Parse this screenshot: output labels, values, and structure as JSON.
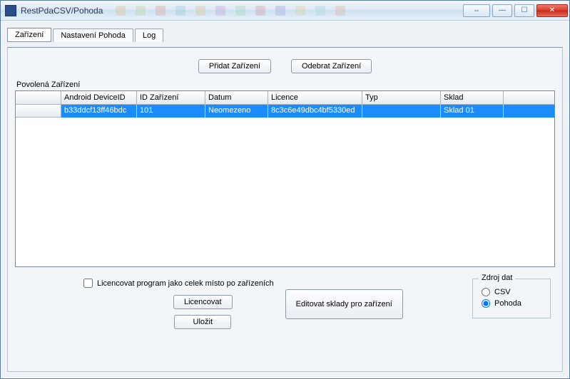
{
  "window": {
    "title": "RestPdaCSV/Pohoda"
  },
  "tabs": {
    "items": [
      {
        "label": "Zařízení",
        "active": true
      },
      {
        "label": "Nastavení Pohoda",
        "active": false
      },
      {
        "label": "Log",
        "active": false
      }
    ]
  },
  "buttons": {
    "add_device": "Přidat Zařízení",
    "remove_device": "Odebrat Zařízení",
    "license": "Licencovat",
    "save": "Uložit",
    "edit_stores": "Editovat sklady pro zařízení"
  },
  "labels": {
    "allowed_devices": "Povolená Zařízení",
    "license_whole": "Licencovat program jako celek místo po zařízeních"
  },
  "grid": {
    "columns": [
      "",
      "Android DeviceID",
      "ID Zařízení",
      "Datum",
      "Licence",
      "Typ",
      "Sklad"
    ],
    "rows": [
      {
        "row_header": "",
        "android_id": "b33ddcf13ff46bdc",
        "id_device": "101",
        "datum": "Neomezeno",
        "licence": "8c3c6e49dbc4bf5330ed",
        "typ": "",
        "sklad": "Sklad 01",
        "selected": true
      }
    ]
  },
  "datasource": {
    "legend": "Zdroj dat",
    "options": [
      {
        "label": "CSV",
        "checked": false
      },
      {
        "label": "Pohoda",
        "checked": true
      }
    ]
  },
  "checkbox": {
    "license_whole_checked": false
  }
}
